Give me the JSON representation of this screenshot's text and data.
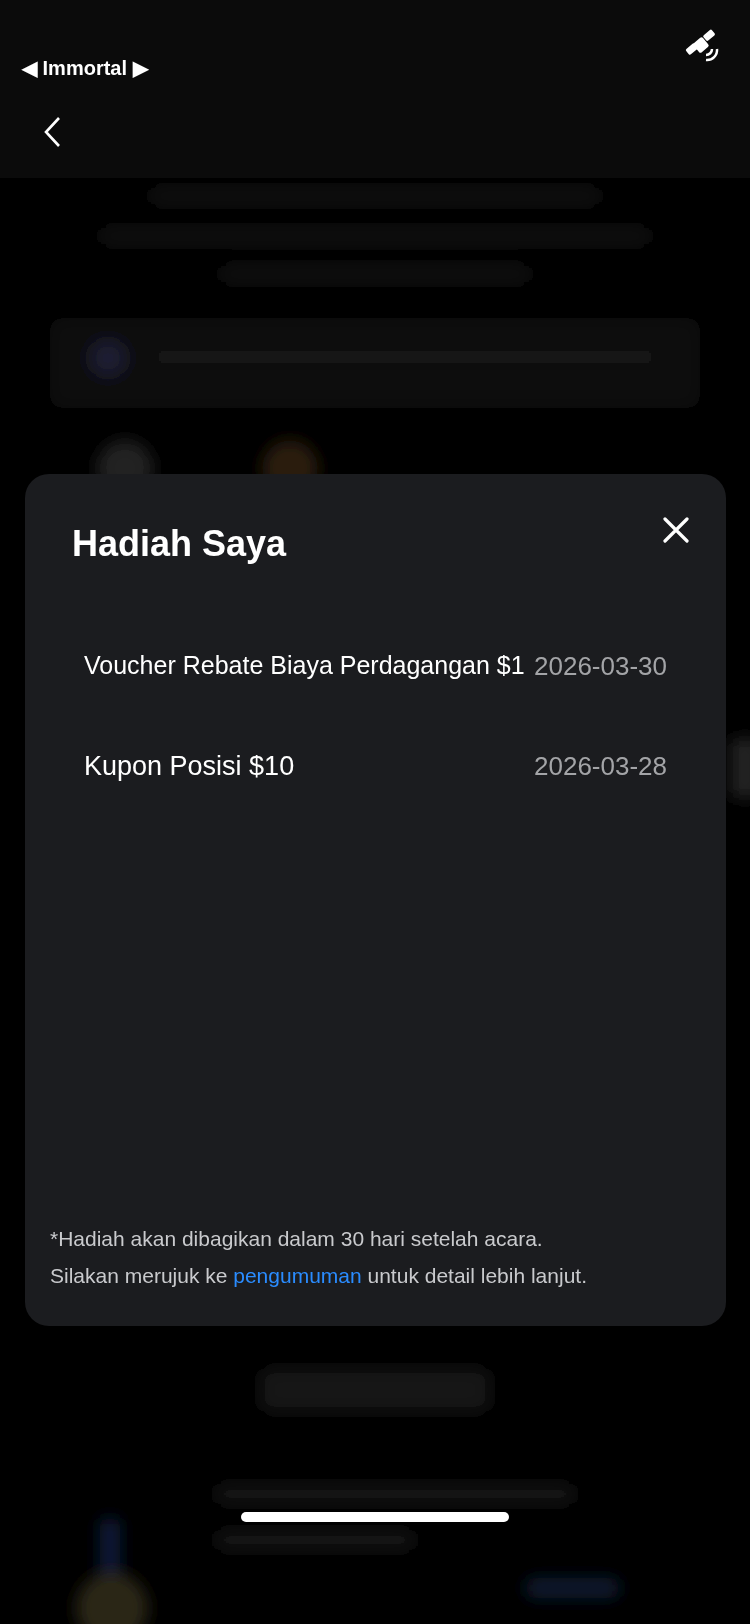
{
  "status_bar": {
    "back_app": "◀ Immortal ▶"
  },
  "modal": {
    "title": "Hadiah Saya",
    "rewards": [
      {
        "name": "Voucher Rebate Biaya Perdagangan $1",
        "date": "2026-03-30"
      },
      {
        "name": "Kupon Posisi $10",
        "date": "2026-03-28"
      }
    ],
    "note": {
      "line_1": "*Hadiah akan dibagikan dalam 30 hari setelah acara.",
      "line_2_before": "Silakan merujuk ke",
      "link": "pengumuman",
      "line_2_after": "untuk detail lebih lanjut."
    }
  }
}
